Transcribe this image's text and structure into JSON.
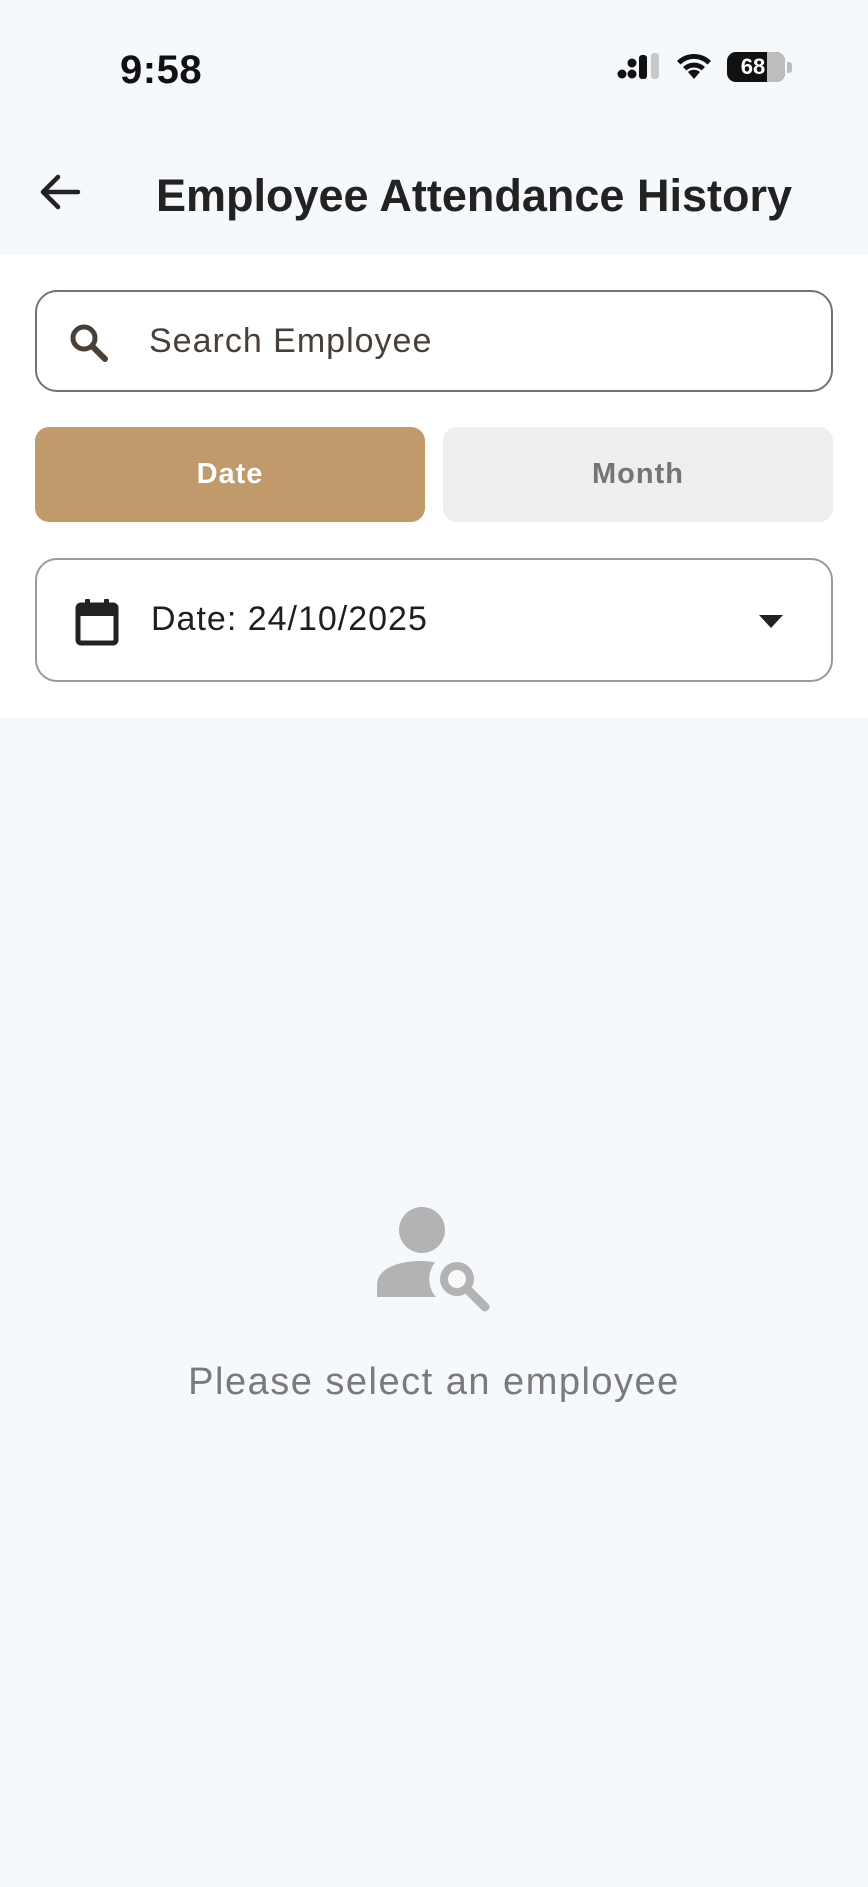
{
  "status_bar": {
    "time": "9:58",
    "battery": "68",
    "icons": [
      "signal-icon",
      "wifi-icon",
      "battery-icon"
    ]
  },
  "header": {
    "title": "Employee Attendance History",
    "back_icon": "arrow-left-icon"
  },
  "search": {
    "placeholder": "Search Employee",
    "value": "",
    "icon": "search-icon"
  },
  "mode_toggle": {
    "options": [
      {
        "label": "Date",
        "selected": true
      },
      {
        "label": "Month",
        "selected": false
      }
    ]
  },
  "date_picker": {
    "label": "Date: 24/10/2025",
    "icon": "calendar-icon",
    "dropdown_icon": "caret-down-icon"
  },
  "empty_state": {
    "icon": "person-search-icon",
    "message": "Please select an employee"
  },
  "colors": {
    "accent": "#c09a6b",
    "background": "#f6f9fc",
    "panel": "#ffffff",
    "muted_text": "#7a7a7a"
  }
}
